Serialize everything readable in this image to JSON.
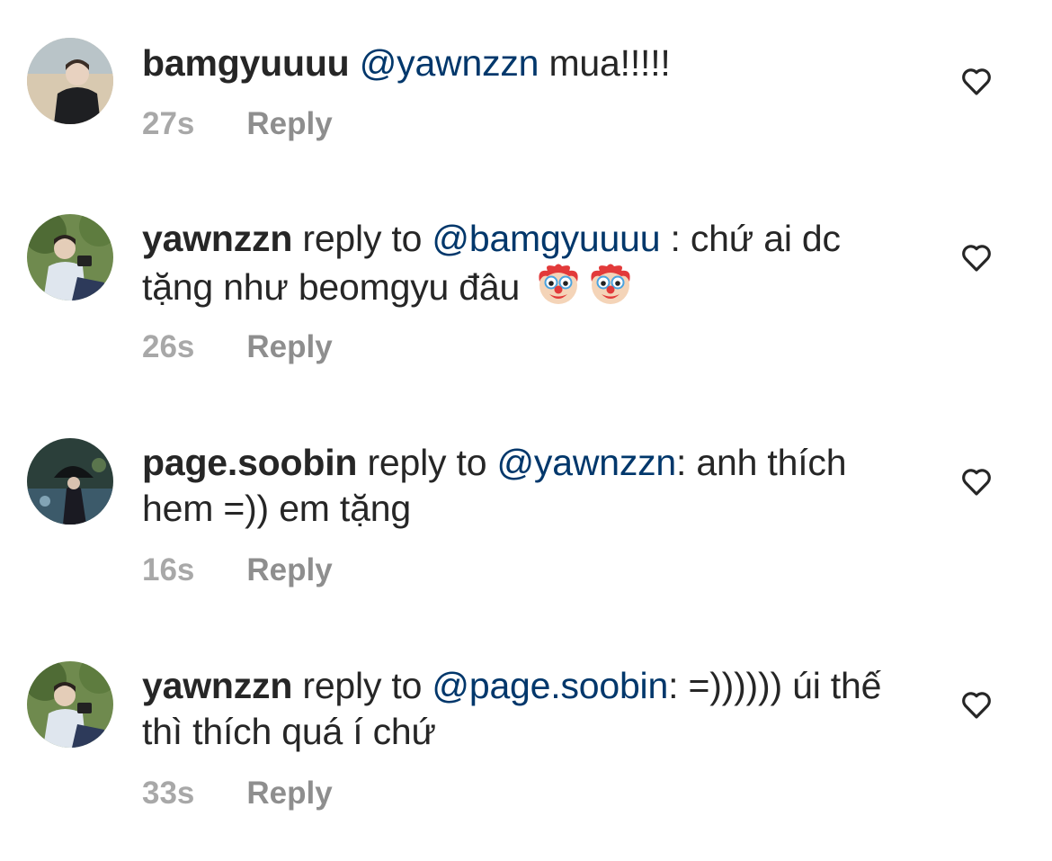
{
  "comments": [
    {
      "username": "bamgyuuuu",
      "mention": "@yawnzzn",
      "text": " mua!!!!!",
      "time": "27s",
      "reply_label": "Reply"
    },
    {
      "username": "yawnzzn",
      "reply_prefix": " reply to ",
      "mention": "@bamgyuuuu",
      "text": " : chứ ai dc tặng như beomgyu đâu ",
      "emojis": [
        "clown-face",
        "clown-face"
      ],
      "time": "26s",
      "reply_label": "Reply"
    },
    {
      "username": "page.soobin",
      "reply_prefix": " reply to ",
      "mention": "@yawnzzn",
      "text": ": anh thích hem =)) em tặng",
      "time": "16s",
      "reply_label": "Reply"
    },
    {
      "username": "yawnzzn",
      "reply_prefix": " reply to ",
      "mention": "@page.soobin",
      "text": ": =)))))) úi thế thì thích quá í chứ",
      "time": "33s",
      "reply_label": "Reply"
    }
  ],
  "colors": {
    "text": "#262626",
    "mention": "#00376b",
    "muted": "#8e8e8e"
  },
  "icons": {
    "like": "heart-outline-icon",
    "emoji": "clown-face-emoji"
  }
}
